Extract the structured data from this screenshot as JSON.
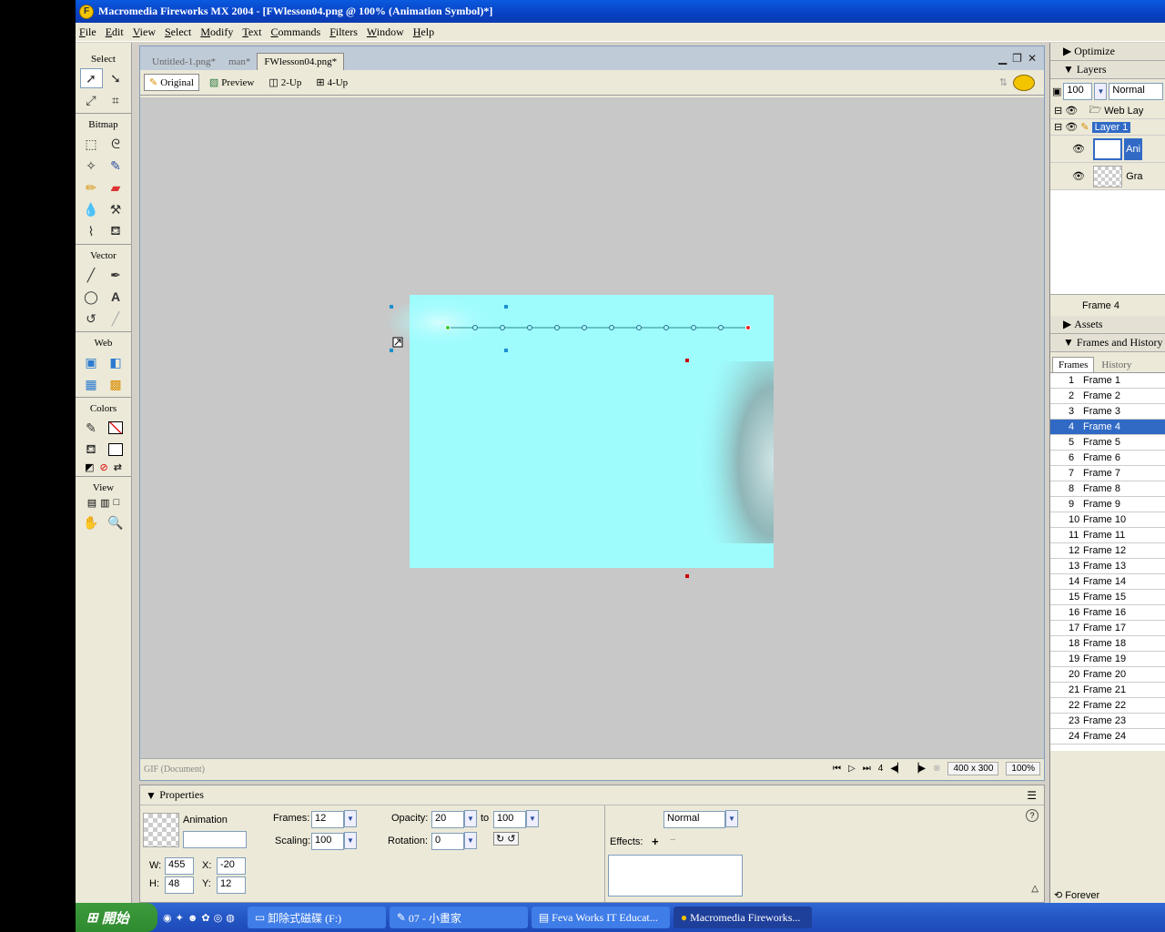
{
  "window": {
    "title": "Macromedia Fireworks MX 2004 - [FWlesson04.png @ 100% (Animation Symbol)*]"
  },
  "menu": [
    "File",
    "Edit",
    "View",
    "Select",
    "Modify",
    "Text",
    "Commands",
    "Filters",
    "Window",
    "Help"
  ],
  "tools": {
    "groups": {
      "select": "Select",
      "bitmap": "Bitmap",
      "vector": "Vector",
      "web": "Web",
      "colors": "Colors",
      "view": "View"
    }
  },
  "document": {
    "tabs": [
      "Untitled-1.png*",
      "man*",
      "FWlesson04.png*"
    ],
    "view_buttons": [
      "Original",
      "Preview",
      "2-Up",
      "4-Up"
    ],
    "status_left": "GIF (Document)",
    "frame_number": "4",
    "size": "400 x 300",
    "zoom": "100%"
  },
  "properties": {
    "header": "Properties",
    "symbol_type": "Animation",
    "frames_label": "Frames:",
    "frames": "12",
    "scaling_label": "Scaling:",
    "scaling": "100",
    "opacity_label": "Opacity:",
    "opacity_from": "20",
    "to_label": "to",
    "opacity_to": "100",
    "rotation_label": "Rotation:",
    "rotation": "0",
    "blend": "Normal",
    "effects_label": "Effects:",
    "w_label": "W:",
    "w": "455",
    "h_label": "H:",
    "h": "48",
    "x_label": "X:",
    "x": "-20",
    "y_label": "Y:",
    "y": "12"
  },
  "panels": {
    "optimize": "Optimize",
    "layers": "Layers",
    "layer_opacity": "100",
    "layer_blend": "Normal",
    "layer_rows": [
      "Web Lay",
      "Layer 1",
      "Ani",
      "Gra"
    ],
    "current_frame": "Frame 4",
    "assets": "Assets",
    "frames_history": "Frames and History",
    "tab_frames": "Frames",
    "tab_history": "History",
    "frames": [
      {
        "n": "1",
        "name": "Frame 1"
      },
      {
        "n": "2",
        "name": "Frame 2"
      },
      {
        "n": "3",
        "name": "Frame 3"
      },
      {
        "n": "4",
        "name": "Frame 4"
      },
      {
        "n": "5",
        "name": "Frame 5"
      },
      {
        "n": "6",
        "name": "Frame 6"
      },
      {
        "n": "7",
        "name": "Frame 7"
      },
      {
        "n": "8",
        "name": "Frame 8"
      },
      {
        "n": "9",
        "name": "Frame 9"
      },
      {
        "n": "10",
        "name": "Frame 10"
      },
      {
        "n": "11",
        "name": "Frame 11"
      },
      {
        "n": "12",
        "name": "Frame 12"
      },
      {
        "n": "13",
        "name": "Frame 13"
      },
      {
        "n": "14",
        "name": "Frame 14"
      },
      {
        "n": "15",
        "name": "Frame 15"
      },
      {
        "n": "16",
        "name": "Frame 16"
      },
      {
        "n": "17",
        "name": "Frame 17"
      },
      {
        "n": "18",
        "name": "Frame 18"
      },
      {
        "n": "19",
        "name": "Frame 19"
      },
      {
        "n": "20",
        "name": "Frame 20"
      },
      {
        "n": "21",
        "name": "Frame 21"
      },
      {
        "n": "22",
        "name": "Frame 22"
      },
      {
        "n": "23",
        "name": "Frame 23"
      },
      {
        "n": "24",
        "name": "Frame 24"
      }
    ],
    "selected_frame": "4",
    "loop": "Forever"
  },
  "taskbar": {
    "start": "開始",
    "items": [
      "卸除式磁碟 (F:)",
      "07 - 小畫家",
      "Feva Works IT Educat...",
      "Macromedia Fireworks..."
    ]
  },
  "colors": {
    "canvas": "#9ffcfd",
    "workspace": "#c8c8c8",
    "selection": "#316ac5"
  }
}
